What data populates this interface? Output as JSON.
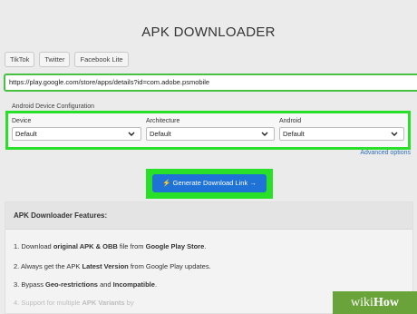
{
  "header": {
    "title": "APK DOWNLOADER"
  },
  "quick_links": [
    "TikTok",
    "Twitter",
    "Facebook Lite"
  ],
  "url_input": {
    "value": "https://play.google.com/store/apps/details?id=com.adobe.psmobile"
  },
  "config": {
    "section_label": "Android Device Configuration",
    "device": {
      "label": "Device",
      "value": "Default"
    },
    "architecture": {
      "label": "Architecture",
      "value": "Default"
    },
    "android": {
      "label": "Android",
      "value": "Default"
    },
    "advanced_link": "Advanced options"
  },
  "generate_button": {
    "label": "⚡ Generate Download Link →"
  },
  "features": {
    "heading": "APK Downloader Features:",
    "item1": {
      "num": "1.",
      "a": "Download ",
      "b": "original APK & OBB",
      "c": " file from ",
      "d": "Google Play Store",
      "e": "."
    },
    "item2": {
      "num": "2.",
      "a": "Always get the APK ",
      "b": "Latest Version",
      "c": " from Google Play updates."
    },
    "item3": {
      "num": "3.",
      "a": "Bypass ",
      "b": "Geo-restrictions",
      "c": " and ",
      "d": "Incompatible",
      "e": "."
    },
    "item4": {
      "num": "4.",
      "a": "Support for multiple ",
      "b": "APK Variants",
      "c": " by"
    }
  },
  "watermark": {
    "wiki": "wiki",
    "how": "How"
  },
  "colors": {
    "highlight": "#28e028",
    "button": "#1f72d6",
    "link": "#2f6fbd"
  }
}
